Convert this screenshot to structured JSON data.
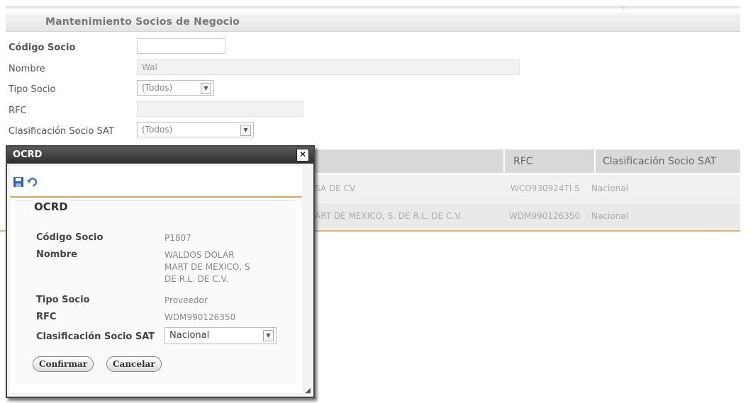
{
  "panel": {
    "title": "Mantenimiento Socios de Negocio",
    "deco": "·:·"
  },
  "form": {
    "codigo_label": "Código Socio",
    "codigo_value": "",
    "nombre_label": "Nombre",
    "nombre_value": "Wal",
    "tipo_label": "Tipo Socio",
    "tipo_value": "(Todos)",
    "rfc_label": "RFC",
    "rfc_value": "",
    "clasif_label": "Clasificación Socio SAT",
    "clasif_value": "(Todos)"
  },
  "grid": {
    "headers": {
      "rfc": "RFC",
      "clasif": "Clasificación Socio SAT"
    },
    "rows": [
      {
        "nombre": "SA DE CV",
        "rfc": "WCO930924TI 5",
        "clasif": "Nacional"
      },
      {
        "nombre": "ART DE MEXICO, S. DE R.L. DE C.V.",
        "rfc": "WDM990126350",
        "clasif": "Nacional"
      }
    ]
  },
  "dialog": {
    "title": "OCRD",
    "close_glyph": "✕",
    "section_title": "OCRD",
    "codigo_label": "Código Socio",
    "codigo_value": "P1807",
    "nombre_label": "Nombre",
    "nombre_line1": "WALDOS DOLAR",
    "nombre_line2": "MART DE MEXICO, S",
    "nombre_line3": "DE R.L. DE C.V.",
    "tipo_label": "Tipo Socio",
    "tipo_value": "Proveedor",
    "rfc_label": "RFC",
    "rfc_value": "WDM990126350",
    "clasif_label": "Clasificación Socio SAT",
    "clasif_value": "Nacional",
    "confirm_label": "Confirmar",
    "cancel_label": "Cancelar",
    "icons": [
      "save-icon",
      "undo-icon"
    ]
  },
  "colors": {
    "accent_orange": "#e6a24a",
    "dialog_bar": "#3a3a3a",
    "icon_blue": "#2f63b4"
  }
}
